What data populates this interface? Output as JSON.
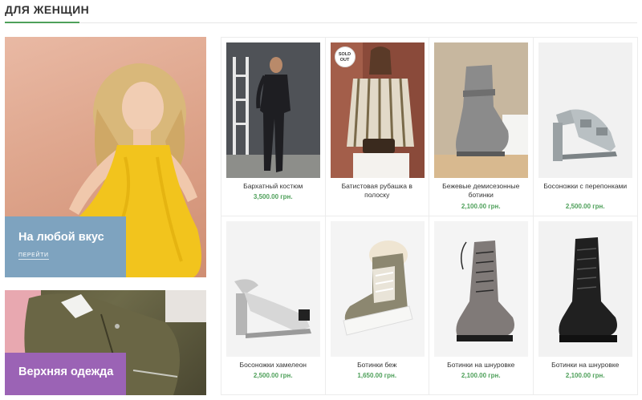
{
  "section": {
    "title": "ДЛЯ ЖЕНЩИН"
  },
  "promos": [
    {
      "title": "На любой вкус",
      "link": "ПЕРЕЙТИ",
      "accent": "#7ea3bf"
    },
    {
      "title": "Верхняя одежда",
      "accent": "#9b63b5"
    }
  ],
  "colors": {
    "price": "#4ea05a",
    "underline": "#4ea05a"
  },
  "products": [
    {
      "name": "Бархатный костюм",
      "price": "3,500.00 грн."
    },
    {
      "name": "Батистовая рубашка в полоску",
      "price": "",
      "badge": "SOLD OUT"
    },
    {
      "name": "Бежевые демисезонные ботинки",
      "price": "2,100.00 грн."
    },
    {
      "name": "Босоножки с перепонками",
      "price": "2,500.00 грн."
    },
    {
      "name": "Босоножки хамелеон",
      "price": "2,500.00 грн."
    },
    {
      "name": "Ботинки беж",
      "price": "1,650.00 грн."
    },
    {
      "name": "Ботинки на шнуровке",
      "price": "2,100.00 грн."
    },
    {
      "name": "Ботинки на шнуровке",
      "price": "2,100.00 грн."
    }
  ]
}
